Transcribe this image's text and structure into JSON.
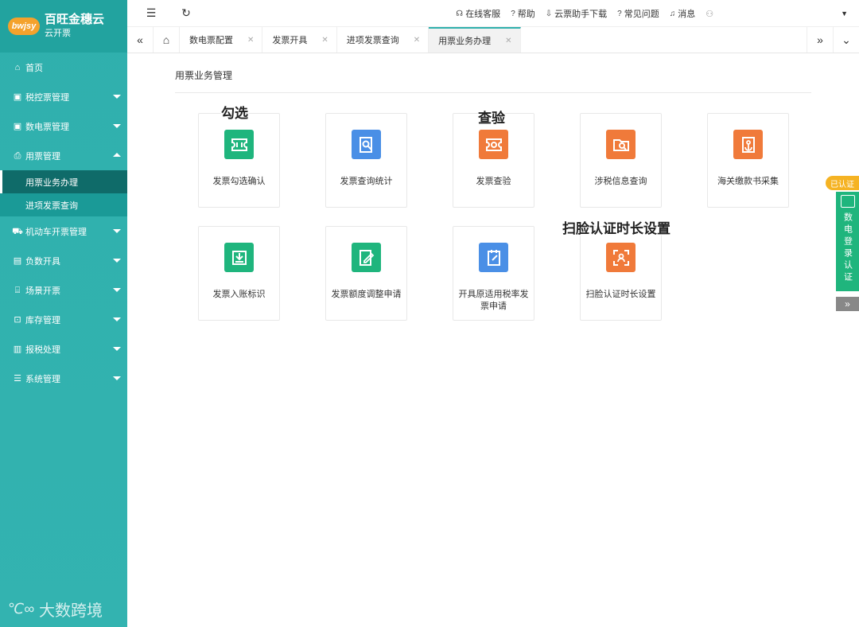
{
  "logo": {
    "badge": "bwjsy",
    "name": "百旺金穗云",
    "sub": "云开票"
  },
  "sidebar": {
    "items": [
      {
        "label": "首页",
        "icon": "home-icon"
      },
      {
        "label": "税控票管理",
        "icon": "image-icon"
      },
      {
        "label": "数电票管理",
        "icon": "image-icon"
      },
      {
        "label": "用票管理",
        "icon": "printer-icon"
      },
      {
        "label": "机动车开票管理",
        "icon": "car-icon"
      },
      {
        "label": "负数开具",
        "icon": "document-icon"
      },
      {
        "label": "场景开票",
        "icon": "store-icon"
      },
      {
        "label": "库存管理",
        "icon": "box-icon"
      },
      {
        "label": "报税处理",
        "icon": "chart-icon"
      },
      {
        "label": "系统管理",
        "icon": "sliders-icon"
      }
    ],
    "subitems": [
      {
        "label": "用票业务办理"
      },
      {
        "label": "进项发票查询"
      }
    ]
  },
  "topbar": {
    "links": [
      {
        "label": "在线客服",
        "icon": "headset-icon"
      },
      {
        "label": "帮助",
        "icon": "help-icon"
      },
      {
        "label": "云票助手下载",
        "icon": "download-icon"
      },
      {
        "label": "常见问题",
        "icon": "question-icon"
      },
      {
        "label": "消息",
        "icon": "bell-icon"
      }
    ]
  },
  "tabs": [
    {
      "label": "数电票配置"
    },
    {
      "label": "发票开具"
    },
    {
      "label": "进项发票查询"
    },
    {
      "label": "用票业务办理"
    }
  ],
  "main": {
    "title": "用票业务管理",
    "cards": [
      {
        "label": "发票勾选确认",
        "color": "#1fb57d",
        "icon": "ticket-check-icon"
      },
      {
        "label": "发票查询统计",
        "color": "#4a8fe6",
        "icon": "doc-search-icon"
      },
      {
        "label": "发票查验",
        "color": "#f07a3a",
        "icon": "ticket-verify-icon"
      },
      {
        "label": "涉税信息查询",
        "color": "#f07a3a",
        "icon": "folder-search-icon"
      },
      {
        "label": "海关缴款书采集",
        "color": "#f07a3a",
        "icon": "anchor-doc-icon"
      },
      {
        "label": "发票入账标识",
        "color": "#1fb57d",
        "icon": "inbox-down-icon"
      },
      {
        "label": "发票额度调整申请",
        "color": "#1fb57d",
        "icon": "doc-edit-icon"
      },
      {
        "label": "开具原适用税率发票申请",
        "color": "#4a8fe6",
        "icon": "notepad-icon"
      },
      {
        "label": "扫脸认证时长设置",
        "color": "#f07a3a",
        "icon": "face-scan-icon"
      }
    ],
    "overlays": [
      "勾选",
      "查验",
      "扫脸认证时长设置"
    ]
  },
  "cert": {
    "badge": "已认证",
    "panel": "数电登录认证"
  },
  "watermark": "大数跨境"
}
